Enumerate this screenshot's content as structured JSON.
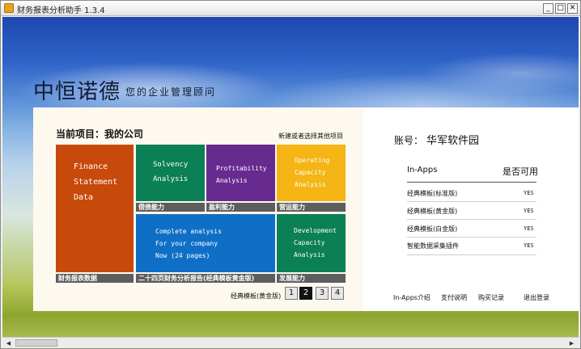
{
  "window": {
    "title": "财务报表分析助手 1.3.4"
  },
  "brand": {
    "name": "中恒诺德",
    "slogan": "您的企业管理顾问"
  },
  "project": {
    "label": "当前项目：我的公司",
    "link": "新建或者选择其他项目"
  },
  "tiles": {
    "finance": [
      "Finance",
      "Statement",
      "Data"
    ],
    "solvency": [
      "Solvency",
      "Analysis"
    ],
    "profitability": [
      "Profitability",
      "Analysis"
    ],
    "operating": [
      "Operating",
      "Capacity",
      "Analysis"
    ],
    "complete": [
      "Complete analysis",
      "For your company",
      "Now (24 pages)"
    ],
    "development": [
      "Development",
      "Capacity",
      "Analysis"
    ]
  },
  "captions": {
    "solvency": "偿债能力",
    "profitability": "盈利能力",
    "operating": "营运能力",
    "finance": "财务报表数据",
    "complete": "二十四页财务分析报告(经典模板黄金版)",
    "development": "发展能力"
  },
  "pager": {
    "label": "经典模板(黄金版)",
    "pages": [
      "1",
      "2",
      "3",
      "4"
    ],
    "active": "2"
  },
  "account": {
    "label": "账号：",
    "value": "华军软件园",
    "col_inapps": "In-Apps",
    "col_available": "是否可用",
    "rows": [
      {
        "name": "经典模板(标准版)",
        "value": "YES"
      },
      {
        "name": "经典模板(黄金版)",
        "value": "YES"
      },
      {
        "name": "经典模板(白金版)",
        "value": "YES"
      },
      {
        "name": "智能数据采集插件",
        "value": "YES"
      }
    ],
    "links": [
      "In-Apps介绍",
      "支付说明",
      "购买记录",
      "退出登录"
    ]
  },
  "colors": {
    "finance": "#c74a0b",
    "solvency": "#0b7f55",
    "profitability": "#672a8e",
    "operating": "#f4b515",
    "complete": "#0f6fc6",
    "development": "#0b7f55"
  }
}
